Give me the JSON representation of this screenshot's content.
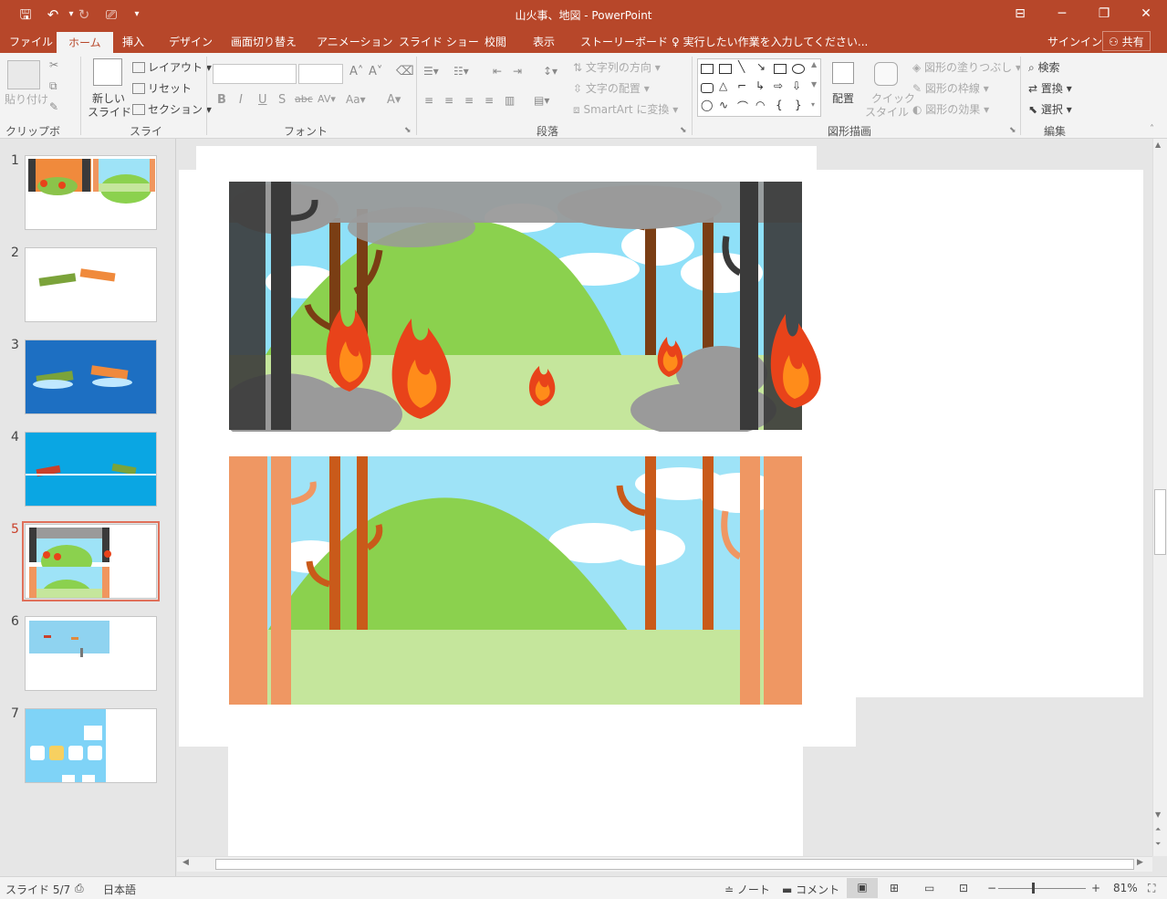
{
  "window": {
    "title": "山火事、地図 - PowerPoint"
  },
  "tabs": [
    {
      "label": "ファイル",
      "active": false
    },
    {
      "label": "ホーム",
      "active": true
    },
    {
      "label": "挿入",
      "active": false
    },
    {
      "label": "デザイン",
      "active": false
    },
    {
      "label": "画面切り替え",
      "active": false
    },
    {
      "label": "アニメーション",
      "active": false
    },
    {
      "label": "スライド ショー",
      "active": false
    },
    {
      "label": "校閲",
      "active": false
    },
    {
      "label": "表示",
      "active": false
    },
    {
      "label": "ストーリーボード",
      "active": false
    }
  ],
  "tell_me": "実行したい作業を入力してください...",
  "signin": "サインイン",
  "share": "共有",
  "ribbon": {
    "clipboard": {
      "label": "クリップボード",
      "paste": "貼り付け"
    },
    "slides": {
      "label": "スライド",
      "new_slide_1": "新しい",
      "new_slide_2": "スライド",
      "layout": "レイアウト",
      "reset": "リセット",
      "section": "セクション"
    },
    "font": {
      "label": "フォント"
    },
    "paragraph": {
      "label": "段落",
      "text_direction": "文字列の方向",
      "align_text": "文字の配置",
      "smartart": "SmartArt に変換"
    },
    "drawing": {
      "label": "図形描画",
      "arrange": "配置",
      "quick_styles_1": "クイック",
      "quick_styles_2": "スタイル",
      "fill": "図形の塗りつぶし",
      "outline": "図形の枠線",
      "effects": "図形の効果"
    },
    "editing": {
      "label": "編集",
      "find": "検索",
      "replace": "置換",
      "select": "選択"
    }
  },
  "slides": [
    {
      "number": "1"
    },
    {
      "number": "2"
    },
    {
      "number": "3"
    },
    {
      "number": "4"
    },
    {
      "number": "5",
      "selected": true
    },
    {
      "number": "6"
    },
    {
      "number": "7"
    }
  ],
  "status": {
    "slide": "スライド 5/7",
    "language": "日本語",
    "notes": "ノート",
    "comments": "コメント",
    "zoom": "81%"
  },
  "colors": {
    "accent": "#b7472a",
    "selection": "#e0705a"
  }
}
